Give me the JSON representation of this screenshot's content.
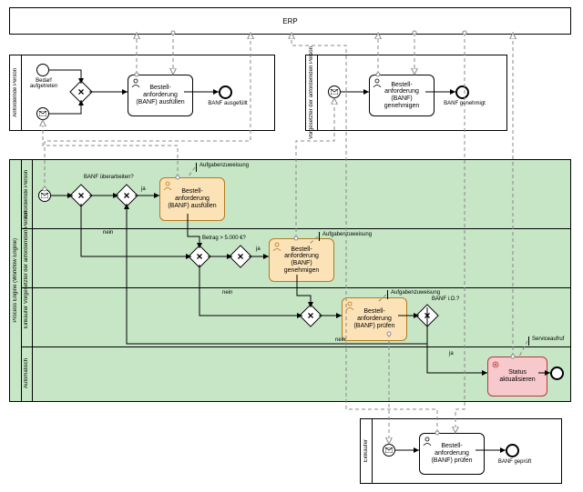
{
  "diagram_type": "BPMN",
  "pools": {
    "erp": {
      "label": "ERP"
    },
    "anfordernde": {
      "label": "Anfordernde Person"
    },
    "vorgesetzter_top": {
      "label": "Vorgesetzter der anfordernden Person"
    },
    "engine": {
      "label": "Process Engine (Workflow Engine)",
      "lanes": {
        "anfordernde": "Anfordernde Person",
        "vorgesetzter": "Vorgesetzter der anfordernden Person",
        "einkaeufer": "Einkäufer",
        "automatisch": "Automatisch"
      }
    },
    "einkaeufer_bottom": {
      "label": "Einkäufer"
    }
  },
  "events": {
    "ap_start1": {
      "type": "none",
      "label": "Bedarf aufgetreten"
    },
    "ap_start2": {
      "type": "message"
    },
    "ap_end": {
      "type": "end",
      "label": "BANF ausgefüllt"
    },
    "vg_start": {
      "type": "message"
    },
    "vg_end": {
      "type": "end",
      "label": "BANF genehmigt"
    },
    "pe_start": {
      "type": "message"
    },
    "pe_end": {
      "type": "end"
    },
    "ek_start": {
      "type": "message"
    },
    "ek_end": {
      "type": "end",
      "label": "BANF geprüft"
    }
  },
  "tasks": {
    "ap_fill": {
      "label": "Bestell-\nanforderung (BANF) ausfüllen",
      "type": "user"
    },
    "vg_approve": {
      "label": "Bestell-\nanforderung (BANF) genehmigen",
      "type": "user"
    },
    "pe_fill": {
      "label": "Bestell-\nanforderung (BANF) ausfüllen",
      "type": "user-task"
    },
    "pe_approve": {
      "label": "Bestell-\nanforderung (BANF) genehmigen",
      "type": "user-task"
    },
    "pe_check": {
      "label": "Bestell-\nanforderung (BANF) prüfen",
      "type": "user-task"
    },
    "pe_status": {
      "label": "Status aktualisieren",
      "type": "service-task"
    },
    "ek_check": {
      "label": "Bestell-\nanforderung (BANF) prüfen",
      "type": "user"
    }
  },
  "gateways": {
    "ap_merge": {
      "type": "xor"
    },
    "pe_g1": {
      "type": "xor",
      "label": "BANF überarbeiten?"
    },
    "pe_g2": {
      "type": "xor"
    },
    "pe_g3": {
      "type": "xor",
      "label": "Betrag > 5.000 €?"
    },
    "pe_g4": {
      "type": "xor"
    },
    "pe_g5": {
      "type": "xor"
    },
    "pe_g6": {
      "type": "xor",
      "label": "BANF i.O.?"
    }
  },
  "labels": {
    "ja": "ja",
    "nein": "nein"
  },
  "annotations": {
    "a1": "Aufgabenzuweisung",
    "a2": "Aufgabenzuweisung",
    "a3": "Aufgabenzuweisung",
    "a4": "Serviceaufruf"
  },
  "chart_data": {
    "type": "bpmn",
    "pools": [
      {
        "id": "erp",
        "name": "ERP",
        "lanes": []
      },
      {
        "id": "anfordernde",
        "name": "Anfordernde Person",
        "lanes": [],
        "elements": [
          {
            "id": "ap_start1",
            "type": "startEvent",
            "name": "Bedarf aufgetreten"
          },
          {
            "id": "ap_start2",
            "type": "startEvent-message"
          },
          {
            "id": "ap_merge",
            "type": "exclusiveGateway"
          },
          {
            "id": "ap_fill",
            "type": "userTask",
            "name": "Bestellanforderung (BANF) ausfüllen"
          },
          {
            "id": "ap_end",
            "type": "endEvent",
            "name": "BANF ausgefüllt"
          }
        ]
      },
      {
        "id": "vorgesetzter_top",
        "name": "Vorgesetzter der anfordernden Person",
        "lanes": [],
        "elements": [
          {
            "id": "vg_start",
            "type": "startEvent-message"
          },
          {
            "id": "vg_approve",
            "type": "userTask",
            "name": "Bestellanforderung (BANF) genehmigen"
          },
          {
            "id": "vg_end",
            "type": "endEvent",
            "name": "BANF genehmigt"
          }
        ]
      },
      {
        "id": "engine",
        "name": "Process Engine (Workflow Engine)",
        "lanes": [
          "Anfordernde Person",
          "Vorgesetzter der anfordernden Person",
          "Einkäufer",
          "Automatisch"
        ],
        "elements": [
          {
            "id": "pe_start",
            "type": "startEvent-message",
            "lane": 0
          },
          {
            "id": "pe_g1",
            "type": "exclusiveGateway",
            "lane": 0,
            "name": "BANF überarbeiten?"
          },
          {
            "id": "pe_g2",
            "type": "exclusiveGateway",
            "lane": 0
          },
          {
            "id": "pe_fill",
            "type": "userTask",
            "lane": 0,
            "name": "Bestellanforderung (BANF) ausfüllen"
          },
          {
            "id": "pe_g3",
            "type": "exclusiveGateway",
            "lane": 1,
            "name": "Betrag > 5.000 €?"
          },
          {
            "id": "pe_g4",
            "type": "exclusiveGateway",
            "lane": 1
          },
          {
            "id": "pe_approve",
            "type": "userTask",
            "lane": 1,
            "name": "Bestellanforderung (BANF) genehmigen"
          },
          {
            "id": "pe_g5",
            "type": "exclusiveGateway",
            "lane": 2
          },
          {
            "id": "pe_check",
            "type": "userTask",
            "lane": 2,
            "name": "Bestellanforderung (BANF) prüfen"
          },
          {
            "id": "pe_g6",
            "type": "exclusiveGateway",
            "lane": 2,
            "name": "BANF i.O.?"
          },
          {
            "id": "pe_status",
            "type": "serviceTask",
            "lane": 3,
            "name": "Status aktualisieren"
          },
          {
            "id": "pe_end",
            "type": "endEvent",
            "lane": 3
          }
        ]
      },
      {
        "id": "einkaeufer_bottom",
        "name": "Einkäufer",
        "lanes": [],
        "elements": [
          {
            "id": "ek_start",
            "type": "startEvent-message"
          },
          {
            "id": "ek_check",
            "type": "userTask",
            "name": "Bestellanforderung (BANF) prüfen"
          },
          {
            "id": "ek_end",
            "type": "endEvent",
            "name": "BANF geprüft"
          }
        ]
      }
    ],
    "sequenceFlows": [
      {
        "from": "ap_start1",
        "to": "ap_merge"
      },
      {
        "from": "ap_start2",
        "to": "ap_merge"
      },
      {
        "from": "ap_merge",
        "to": "ap_fill"
      },
      {
        "from": "ap_fill",
        "to": "ap_end"
      },
      {
        "from": "vg_start",
        "to": "vg_approve"
      },
      {
        "from": "vg_approve",
        "to": "vg_end"
      },
      {
        "from": "pe_start",
        "to": "pe_g1"
      },
      {
        "from": "pe_g1",
        "to": "pe_g2",
        "label": "ja"
      },
      {
        "from": "pe_g1",
        "to": "pe_g3",
        "label": "nein"
      },
      {
        "from": "pe_g2",
        "to": "pe_fill"
      },
      {
        "from": "pe_fill",
        "to": "pe_g3"
      },
      {
        "from": "pe_g3",
        "to": "pe_g4",
        "label": "ja"
      },
      {
        "from": "pe_g3",
        "to": "pe_g5",
        "label": "nein"
      },
      {
        "from": "pe_g4",
        "to": "pe_approve"
      },
      {
        "from": "pe_approve",
        "to": "pe_g5"
      },
      {
        "from": "pe_g5",
        "to": "pe_check"
      },
      {
        "from": "pe_check",
        "to": "pe_g6"
      },
      {
        "from": "pe_g6",
        "to": "pe_g2",
        "label": "nein"
      },
      {
        "from": "pe_g6",
        "to": "pe_status",
        "label": "ja"
      },
      {
        "from": "pe_status",
        "to": "pe_end"
      }
    ],
    "messageFlows": [
      {
        "from": "erp",
        "to": "ap_fill"
      },
      {
        "from": "erp",
        "to": "vg_approve"
      },
      {
        "from": "ap_fill",
        "to": "erp"
      },
      {
        "from": "vg_approve",
        "to": "erp"
      },
      {
        "from": "pe_fill",
        "to": "ap_start2"
      },
      {
        "from": "pe_approve",
        "to": "vg_start"
      },
      {
        "from": "pe_check",
        "to": "ek_start"
      },
      {
        "from": "pe_status",
        "to": "erp"
      },
      {
        "from": "erp",
        "to": "pe_start"
      },
      {
        "from": "ek_check",
        "to": "erp"
      },
      {
        "from": "erp",
        "to": "ek_check"
      }
    ],
    "annotations": [
      {
        "text": "Aufgabenzuweisung",
        "attachedTo": "pe_fill"
      },
      {
        "text": "Aufgabenzuweisung",
        "attachedTo": "pe_approve"
      },
      {
        "text": "Aufgabenzuweisung",
        "attachedTo": "pe_check"
      },
      {
        "text": "Serviceaufruf",
        "attachedTo": "pe_status"
      }
    ],
    "conditions": {
      "amount_threshold_eur": 5000
    }
  }
}
